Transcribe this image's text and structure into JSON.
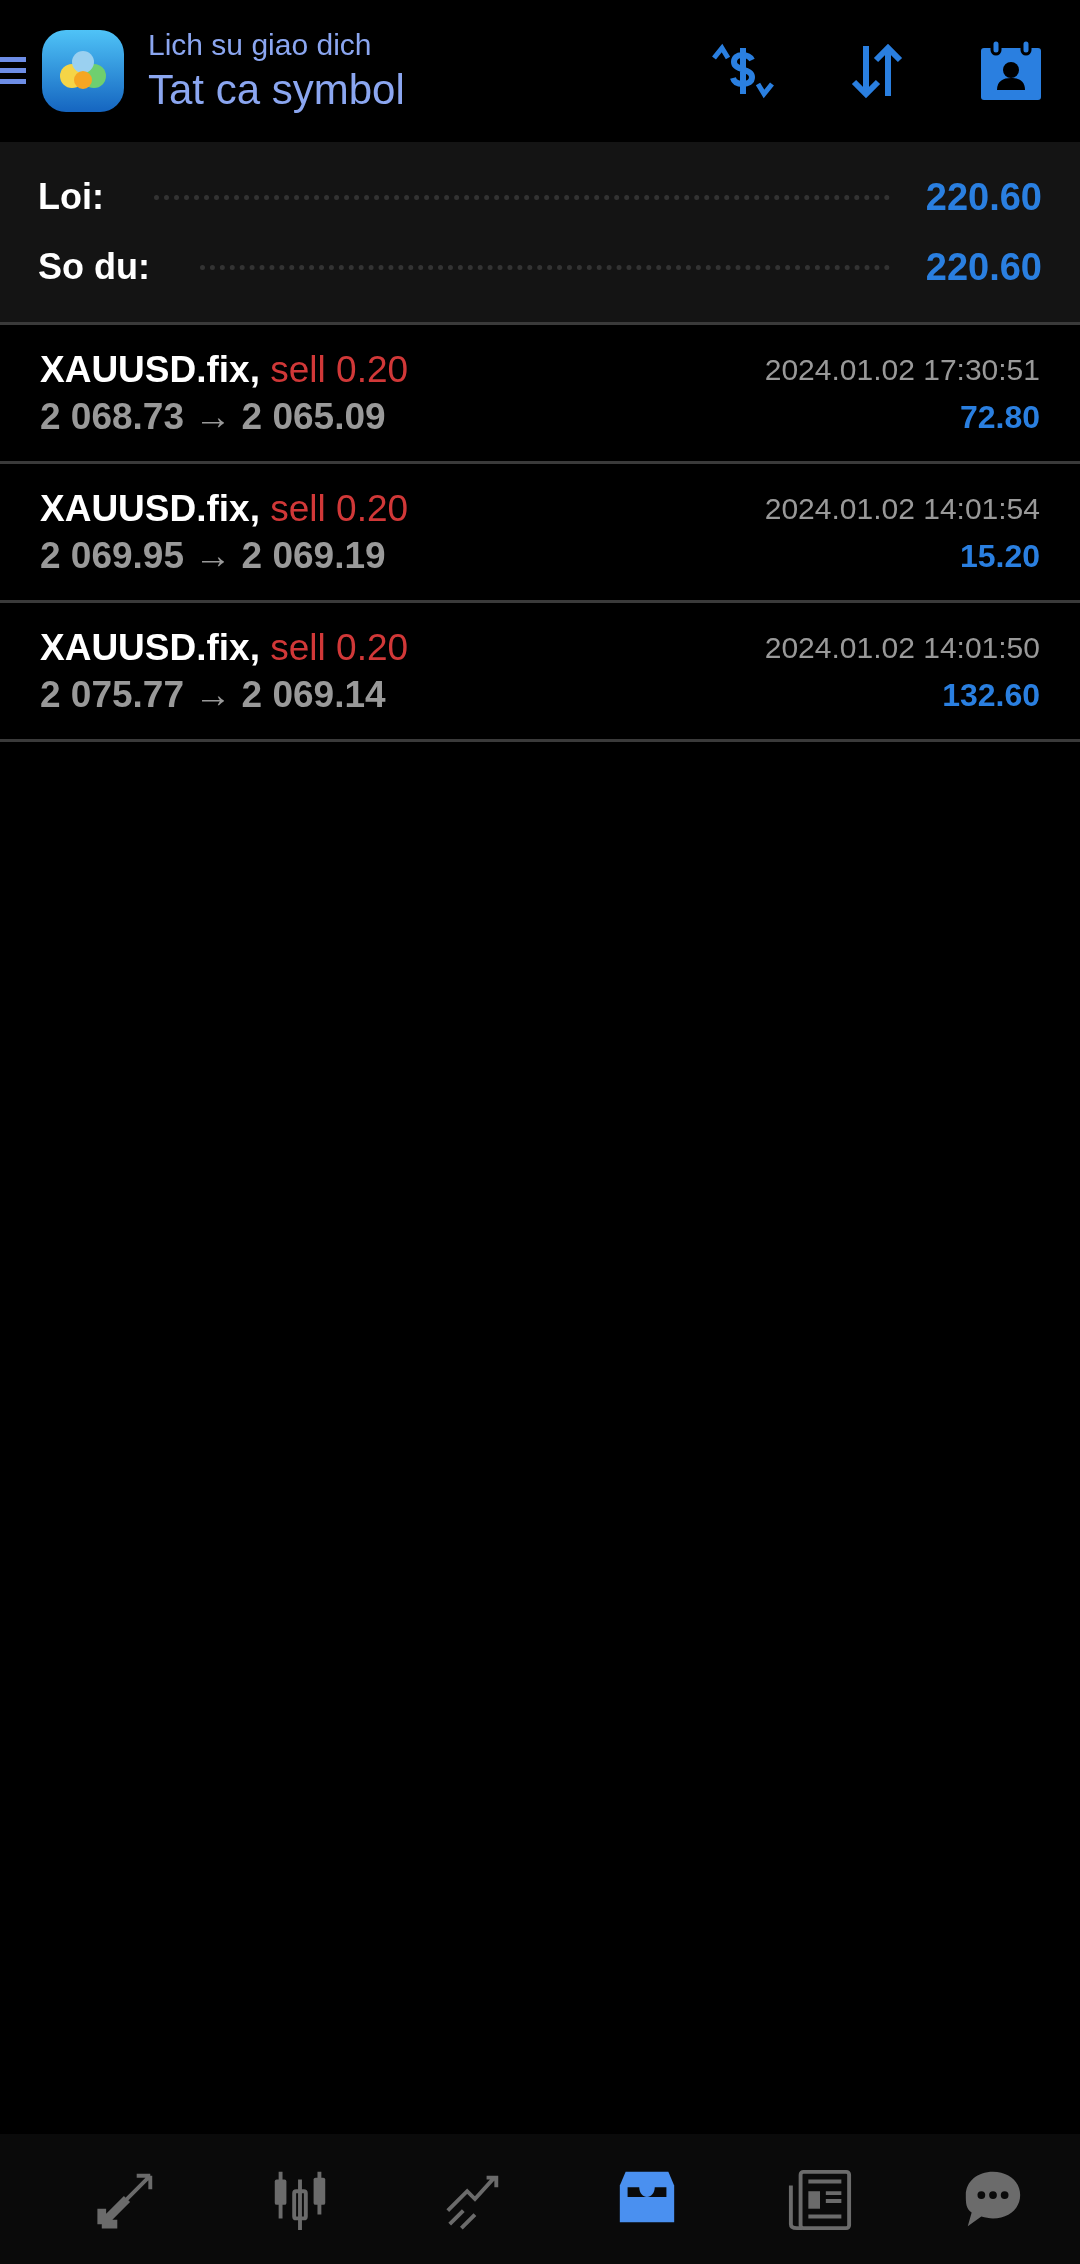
{
  "header": {
    "subtitle": "Lich su giao dich",
    "title": "Tat ca symbol"
  },
  "summary": [
    {
      "label": "Loi:",
      "value": "220.60"
    },
    {
      "label": "So du:",
      "value": "220.60"
    }
  ],
  "deals": [
    {
      "symbol": "XAUUSD.fix,",
      "side": "sell 0.20",
      "prices": "2 068.73 → 2 065.09",
      "time": "2024.01.02 17:30:51",
      "profit": "72.80"
    },
    {
      "symbol": "XAUUSD.fix,",
      "side": "sell 0.20",
      "prices": "2 069.95 → 2 069.19",
      "time": "2024.01.02 14:01:54",
      "profit": "15.20"
    },
    {
      "symbol": "XAUUSD.fix,",
      "side": "sell 0.20",
      "prices": "2 075.77 → 2 069.14",
      "time": "2024.01.02 14:01:50",
      "profit": "132.60"
    }
  ],
  "nav": [
    {
      "kind": "trade",
      "selected": false
    },
    {
      "kind": "chart",
      "selected": false
    },
    {
      "kind": "trend",
      "selected": false
    },
    {
      "kind": "history",
      "selected": true
    },
    {
      "kind": "news",
      "selected": false
    },
    {
      "kind": "chat",
      "selected": false
    }
  ]
}
